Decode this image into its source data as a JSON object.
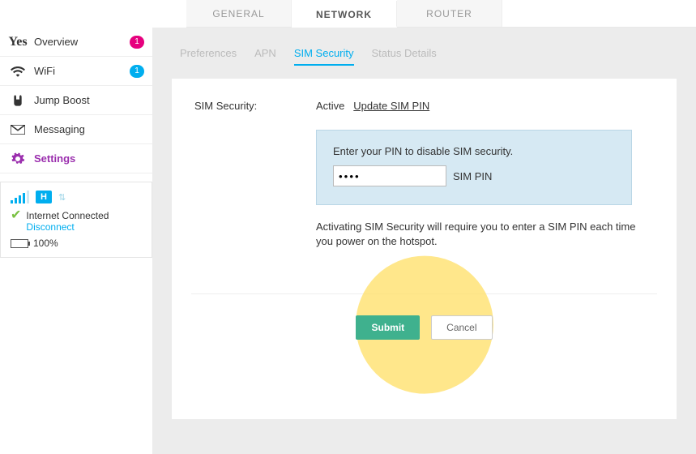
{
  "top_tabs": {
    "general": "GENERAL",
    "network": "NETWORK",
    "router": "ROUTER"
  },
  "sidebar": {
    "items": [
      {
        "label": "Overview",
        "badge": "1"
      },
      {
        "label": "WiFi",
        "badge": "1"
      },
      {
        "label": "Jump Boost"
      },
      {
        "label": "Messaging"
      },
      {
        "label": "Settings"
      }
    ]
  },
  "status": {
    "net_badge": "H",
    "connected_label": "Internet Connected",
    "disconnect_label": "Disconnect",
    "battery_pct": "100%"
  },
  "sub_tabs": {
    "preferences": "Preferences",
    "apn": "APN",
    "sim_security": "SIM Security",
    "status_details": "Status Details"
  },
  "sim": {
    "label": "SIM Security:",
    "state": "Active",
    "update_link": "Update SIM PIN",
    "pin_hint": "Enter your PIN to disable SIM security.",
    "pin_value": "••••",
    "pin_field_label": "SIM PIN",
    "note": "Activating SIM Security will require you to enter a SIM PIN each time you power on the hotspot."
  },
  "actions": {
    "submit": "Submit",
    "cancel": "Cancel"
  }
}
